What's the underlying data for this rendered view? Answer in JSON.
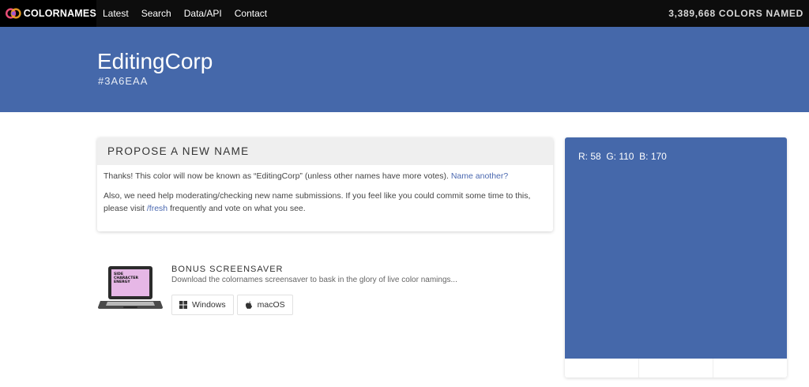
{
  "nav": {
    "brand": "COLORNAMES",
    "links": [
      "Latest",
      "Search",
      "Data/API",
      "Contact"
    ],
    "counter": "3,389,668 COLORS NAMED"
  },
  "color": {
    "name": "EditingCorp",
    "hex": "#3A6EAA",
    "bg": "#4568aa",
    "rgb": "R: 58  G: 110  B: 170"
  },
  "propose": {
    "heading": "PROPOSE A NEW NAME",
    "p1_text": "Thanks! This color will now be known as “EditingCorp” (unless other names have more votes).",
    "p1_link": "Name another?",
    "p2_text_a": "Also, we need help moderating/checking new name submissions. If you feel like you could commit some time to this, please visit",
    "p2_link": "/fresh",
    "p2_text_b": "frequently and vote on what you see."
  },
  "screensaver": {
    "title": "BONUS SCREENSAVER",
    "description": "Download the colornames screensaver to bask in the glory of live color namings...",
    "windows_label": "Windows",
    "macos_label": "macOS",
    "screen_text": [
      "SIDE",
      "CHARACTER",
      "ENERGY"
    ]
  },
  "icons": {
    "brand": "colornames-logo-icon",
    "windows": "windows-icon",
    "apple": "apple-icon",
    "laptop": "laptop-illustration-icon"
  }
}
